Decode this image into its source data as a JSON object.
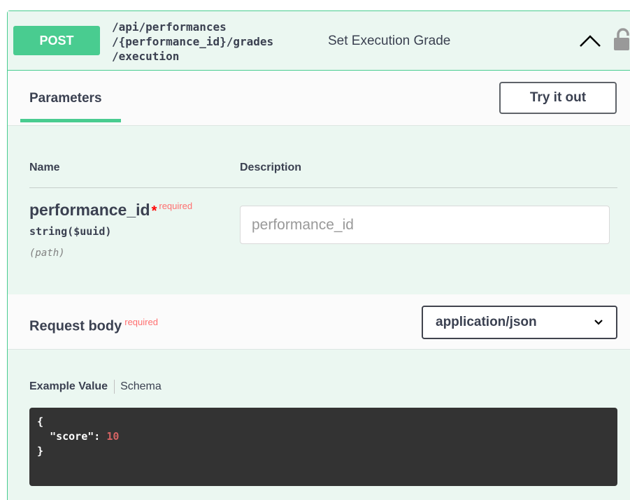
{
  "operation": {
    "method": "POST",
    "path_lines": [
      "/api/performances",
      "/{performance_id}/grades",
      "/execution"
    ],
    "summary": "Set Execution Grade",
    "method_color": "#49cc90"
  },
  "tabs": {
    "parameters_label": "Parameters",
    "try_it_out_label": "Try it out"
  },
  "parameters": {
    "name_header": "Name",
    "description_header": "Description",
    "items": [
      {
        "name": "performance_id",
        "star": "*",
        "required_label": "required",
        "type": "string($uuid)",
        "in": "(path)",
        "placeholder": "performance_id"
      }
    ]
  },
  "request_body": {
    "label": "Request body",
    "required_label": "required",
    "content_type": "application/json"
  },
  "example": {
    "value_tab": "Example Value",
    "schema_tab": "Schema",
    "open_brace": "{",
    "key": "\"score\"",
    "colon": ": ",
    "value": "10",
    "close_brace": "}"
  },
  "icons": [
    "chevron-up-icon",
    "unlock-icon",
    "chevron-down-icon"
  ]
}
